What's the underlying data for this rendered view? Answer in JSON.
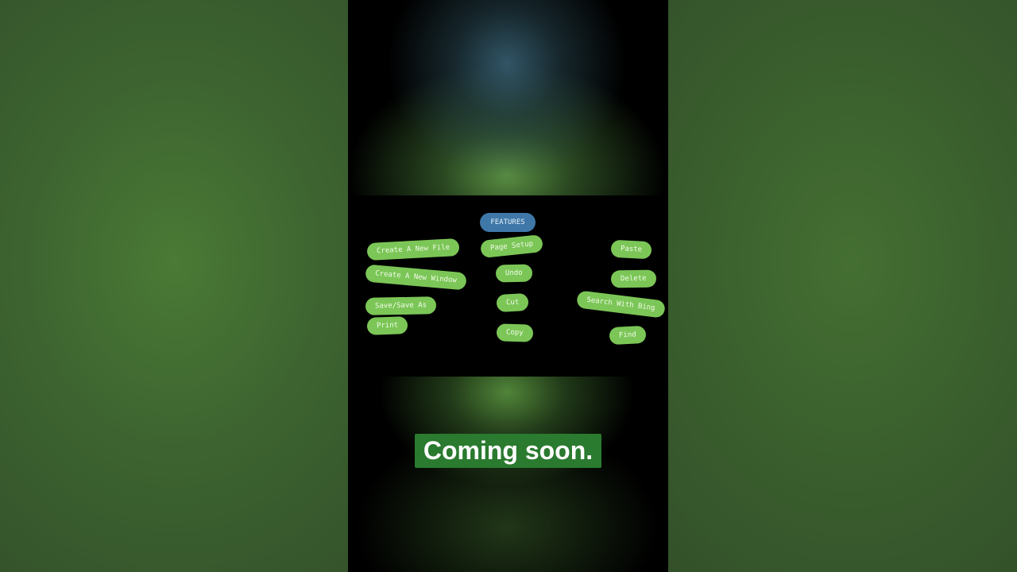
{
  "panel": {
    "features_label": "FEATURES",
    "left_items": [
      "Create A New File",
      "Create A New Window",
      "Save/Save As",
      "Print"
    ],
    "middle_items": [
      "Page Setup",
      "Undo",
      "Cut",
      "Copy"
    ],
    "right_items": [
      "Paste",
      "Delete",
      "Search With Bing",
      "Find"
    ]
  },
  "caption": "Coming soon.",
  "colors": {
    "pill_green": "#7bc657",
    "features_blue": "#3f78a8",
    "caption_bg": "#2a7a2f",
    "background_green": "#3a5a2e"
  }
}
